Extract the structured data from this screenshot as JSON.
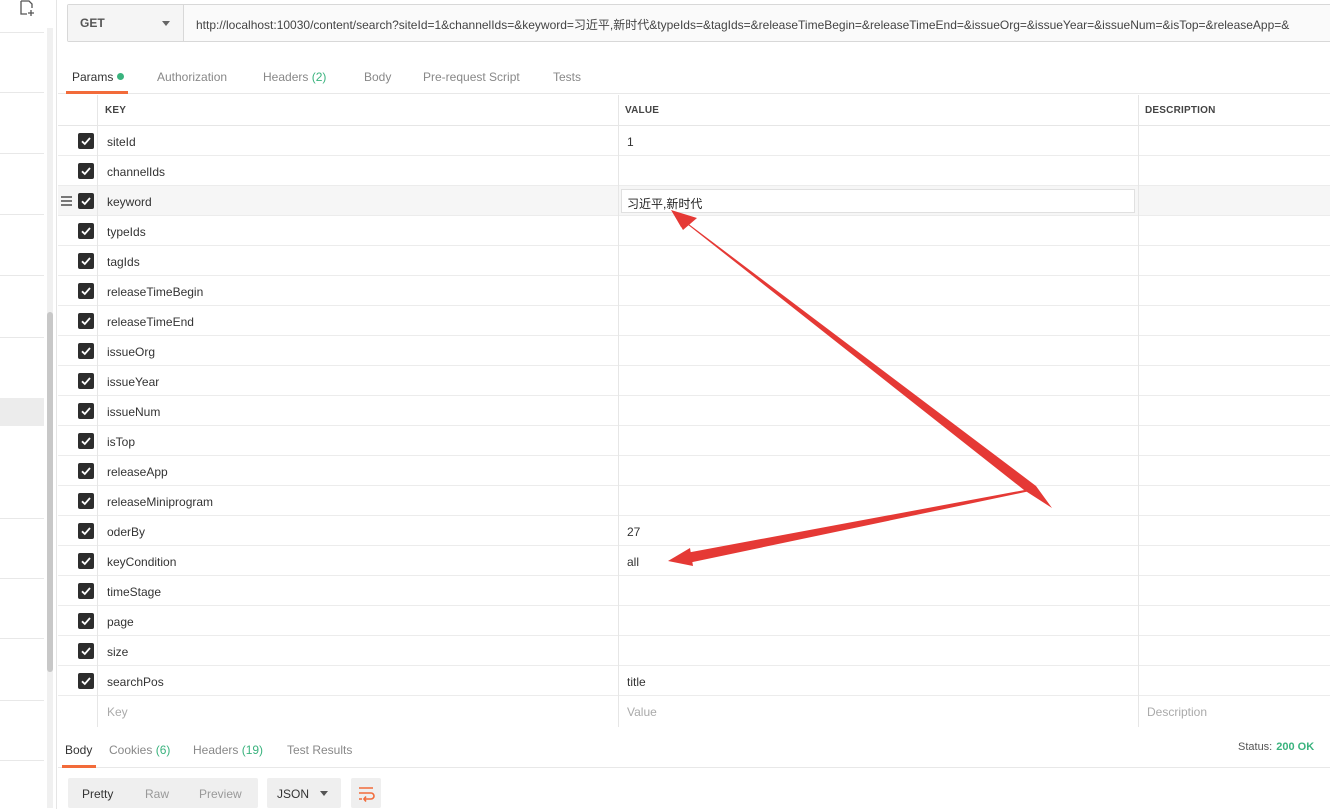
{
  "request": {
    "method": "GET",
    "url": "http://localhost:10030/content/search?siteId=1&channelIds=&keyword=习近平,新时代&typeIds=&tagIds=&releaseTimeBegin=&releaseTimeEnd=&issueOrg=&issueYear=&issueNum=&isTop=&releaseApp=&"
  },
  "tabs": {
    "params": "Params",
    "authorization": "Authorization",
    "headers": "Headers",
    "headers_count": "(2)",
    "body": "Body",
    "prerequest": "Pre-request Script",
    "tests": "Tests"
  },
  "table": {
    "col_key": "KEY",
    "col_value": "VALUE",
    "col_description": "DESCRIPTION",
    "rows": [
      {
        "key": "siteId",
        "value": "1"
      },
      {
        "key": "channelIds",
        "value": ""
      },
      {
        "key": "keyword",
        "value": "习近平,新时代"
      },
      {
        "key": "typeIds",
        "value": ""
      },
      {
        "key": "tagIds",
        "value": ""
      },
      {
        "key": "releaseTimeBegin",
        "value": ""
      },
      {
        "key": "releaseTimeEnd",
        "value": ""
      },
      {
        "key": "issueOrg",
        "value": ""
      },
      {
        "key": "issueYear",
        "value": ""
      },
      {
        "key": "issueNum",
        "value": ""
      },
      {
        "key": "isTop",
        "value": ""
      },
      {
        "key": "releaseApp",
        "value": ""
      },
      {
        "key": "releaseMiniprogram",
        "value": ""
      },
      {
        "key": "oderBy",
        "value": "27"
      },
      {
        "key": "keyCondition",
        "value": "all"
      },
      {
        "key": "timeStage",
        "value": ""
      },
      {
        "key": "page",
        "value": ""
      },
      {
        "key": "size",
        "value": ""
      },
      {
        "key": "searchPos",
        "value": "title"
      }
    ],
    "placeholder_key": "Key",
    "placeholder_value": "Value",
    "placeholder_description": "Description"
  },
  "response": {
    "tab_body": "Body",
    "tab_cookies": "Cookies",
    "cookies_count": "(6)",
    "tab_headers": "Headers",
    "headers_count": "(19)",
    "tab_tests": "Test Results",
    "status_label": "Status:",
    "status_value": "200 OK",
    "view_pretty": "Pretty",
    "view_raw": "Raw",
    "view_preview": "Preview",
    "format": "JSON"
  },
  "colors": {
    "accent": "#f26b3a",
    "success": "#3ab37e",
    "annotation": "#e53935"
  }
}
